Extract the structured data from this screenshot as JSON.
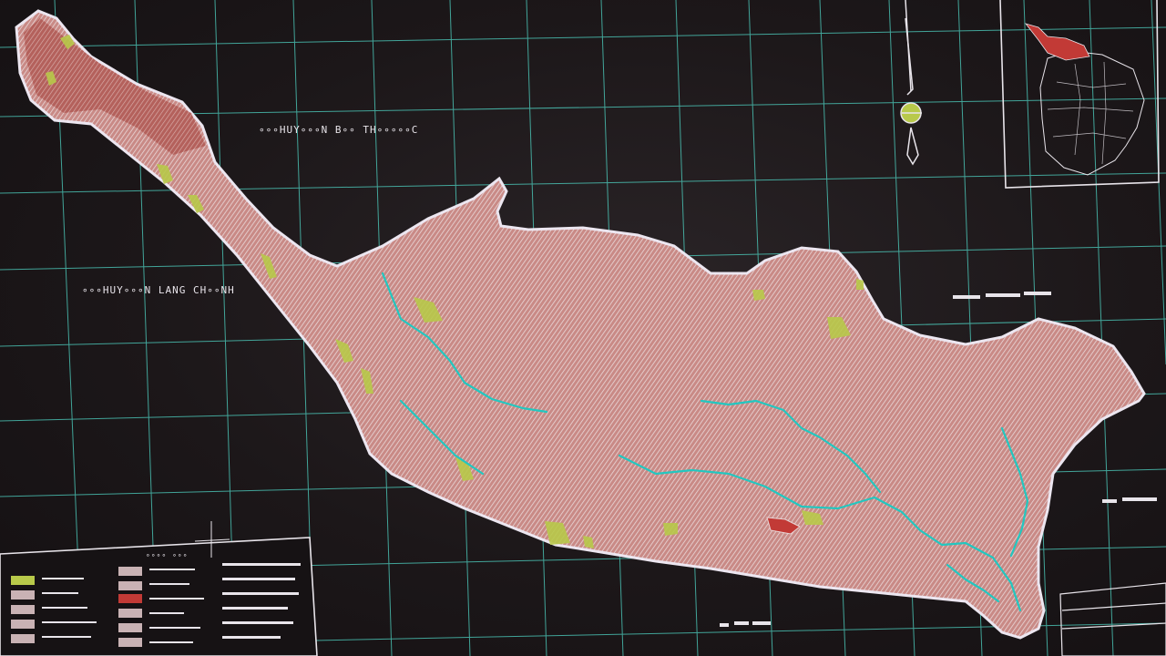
{
  "map": {
    "district_labels": {
      "north": "∘∘∘HUY∘∘∘N B∘∘ TH∘∘∘∘∘C",
      "west": "∘∘∘HUY∘∘∘N LANG CH∘∘NH"
    },
    "colors": {
      "background": "#1a1618",
      "grid": "#4fd4c4",
      "region_fill": "#c98a86",
      "region_hatch": "#e6d6d8",
      "boundary": "#ece6f0",
      "river": "#22c7c0",
      "agri_patch": "#b8c94a",
      "red_zone": "#c23a36",
      "label_text": "#e8e4ea"
    }
  },
  "legend": {
    "title": "∘∘∘∘ ∘∘∘"
  },
  "locator_map": {
    "highlight_color": "#c23a36"
  },
  "north_arrow": {
    "symbol": "north-arrow"
  }
}
